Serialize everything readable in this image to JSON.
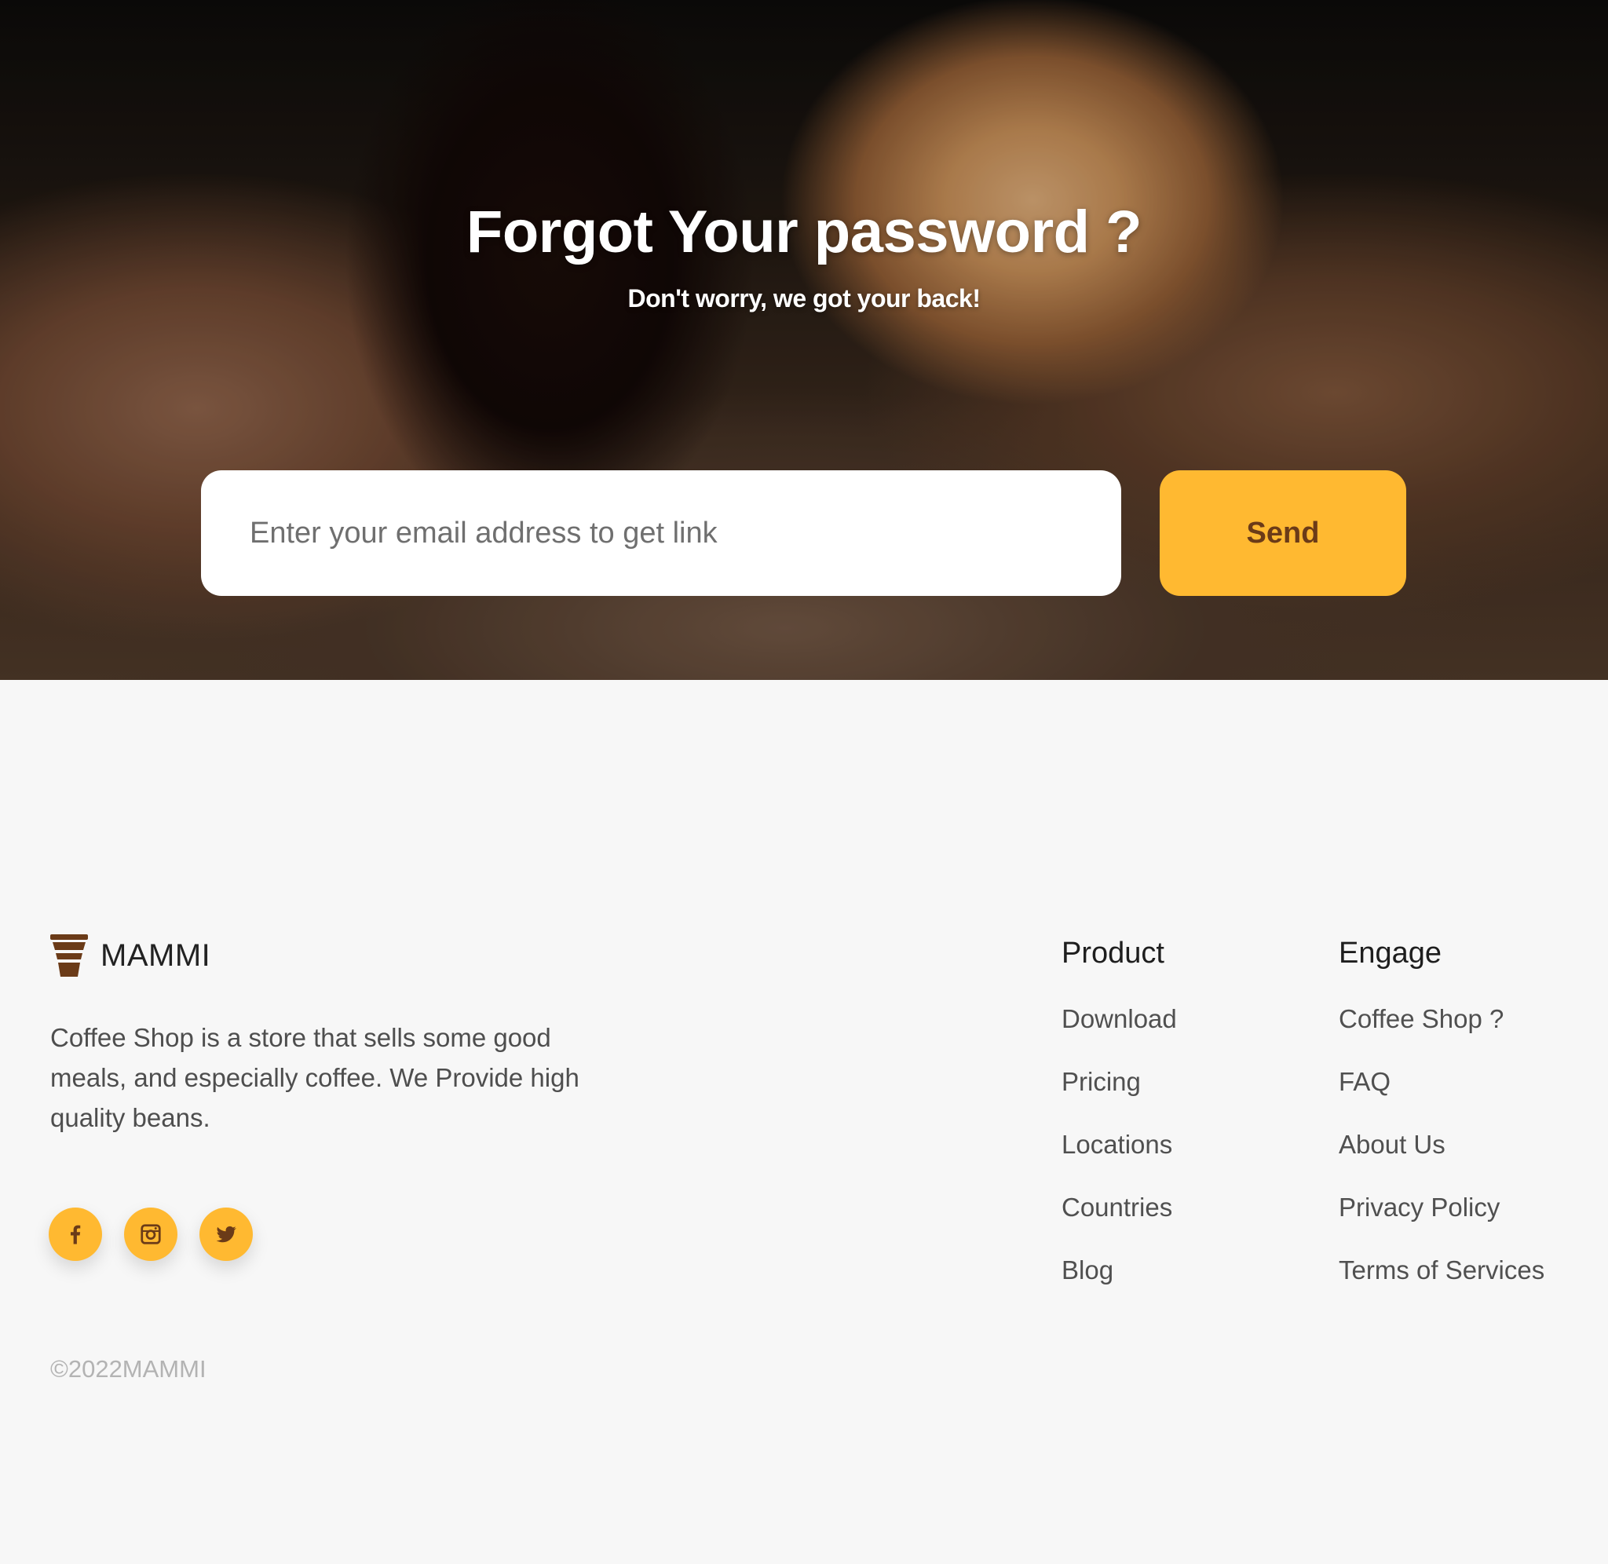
{
  "hero": {
    "title": "Forgot Your password ?",
    "subtitle": "Don't worry, we got your back!",
    "email_placeholder": "Enter your email address to get link",
    "send_label": "Send"
  },
  "footer": {
    "brand": {
      "name": "MAMMI",
      "icon": "coffee-cup-icon"
    },
    "about": "Coffee Shop is a store that sells some good meals, and especially coffee. We Provide high quality beans.",
    "socials": [
      {
        "icon": "facebook-icon"
      },
      {
        "icon": "instagram-icon"
      },
      {
        "icon": "twitter-icon"
      }
    ],
    "product": {
      "heading": "Product",
      "links": [
        "Download",
        "Pricing",
        "Locations",
        "Countries",
        "Blog"
      ]
    },
    "engage": {
      "heading": "Engage",
      "links": [
        "Coffee Shop ?",
        "FAQ",
        "About Us",
        "Privacy Policy",
        "Terms of Services"
      ]
    },
    "copyright": "©2022MAMMI"
  },
  "colors": {
    "accent": "#ffb931",
    "accent_text": "#6b3b18",
    "background": "#f7f7f7"
  }
}
